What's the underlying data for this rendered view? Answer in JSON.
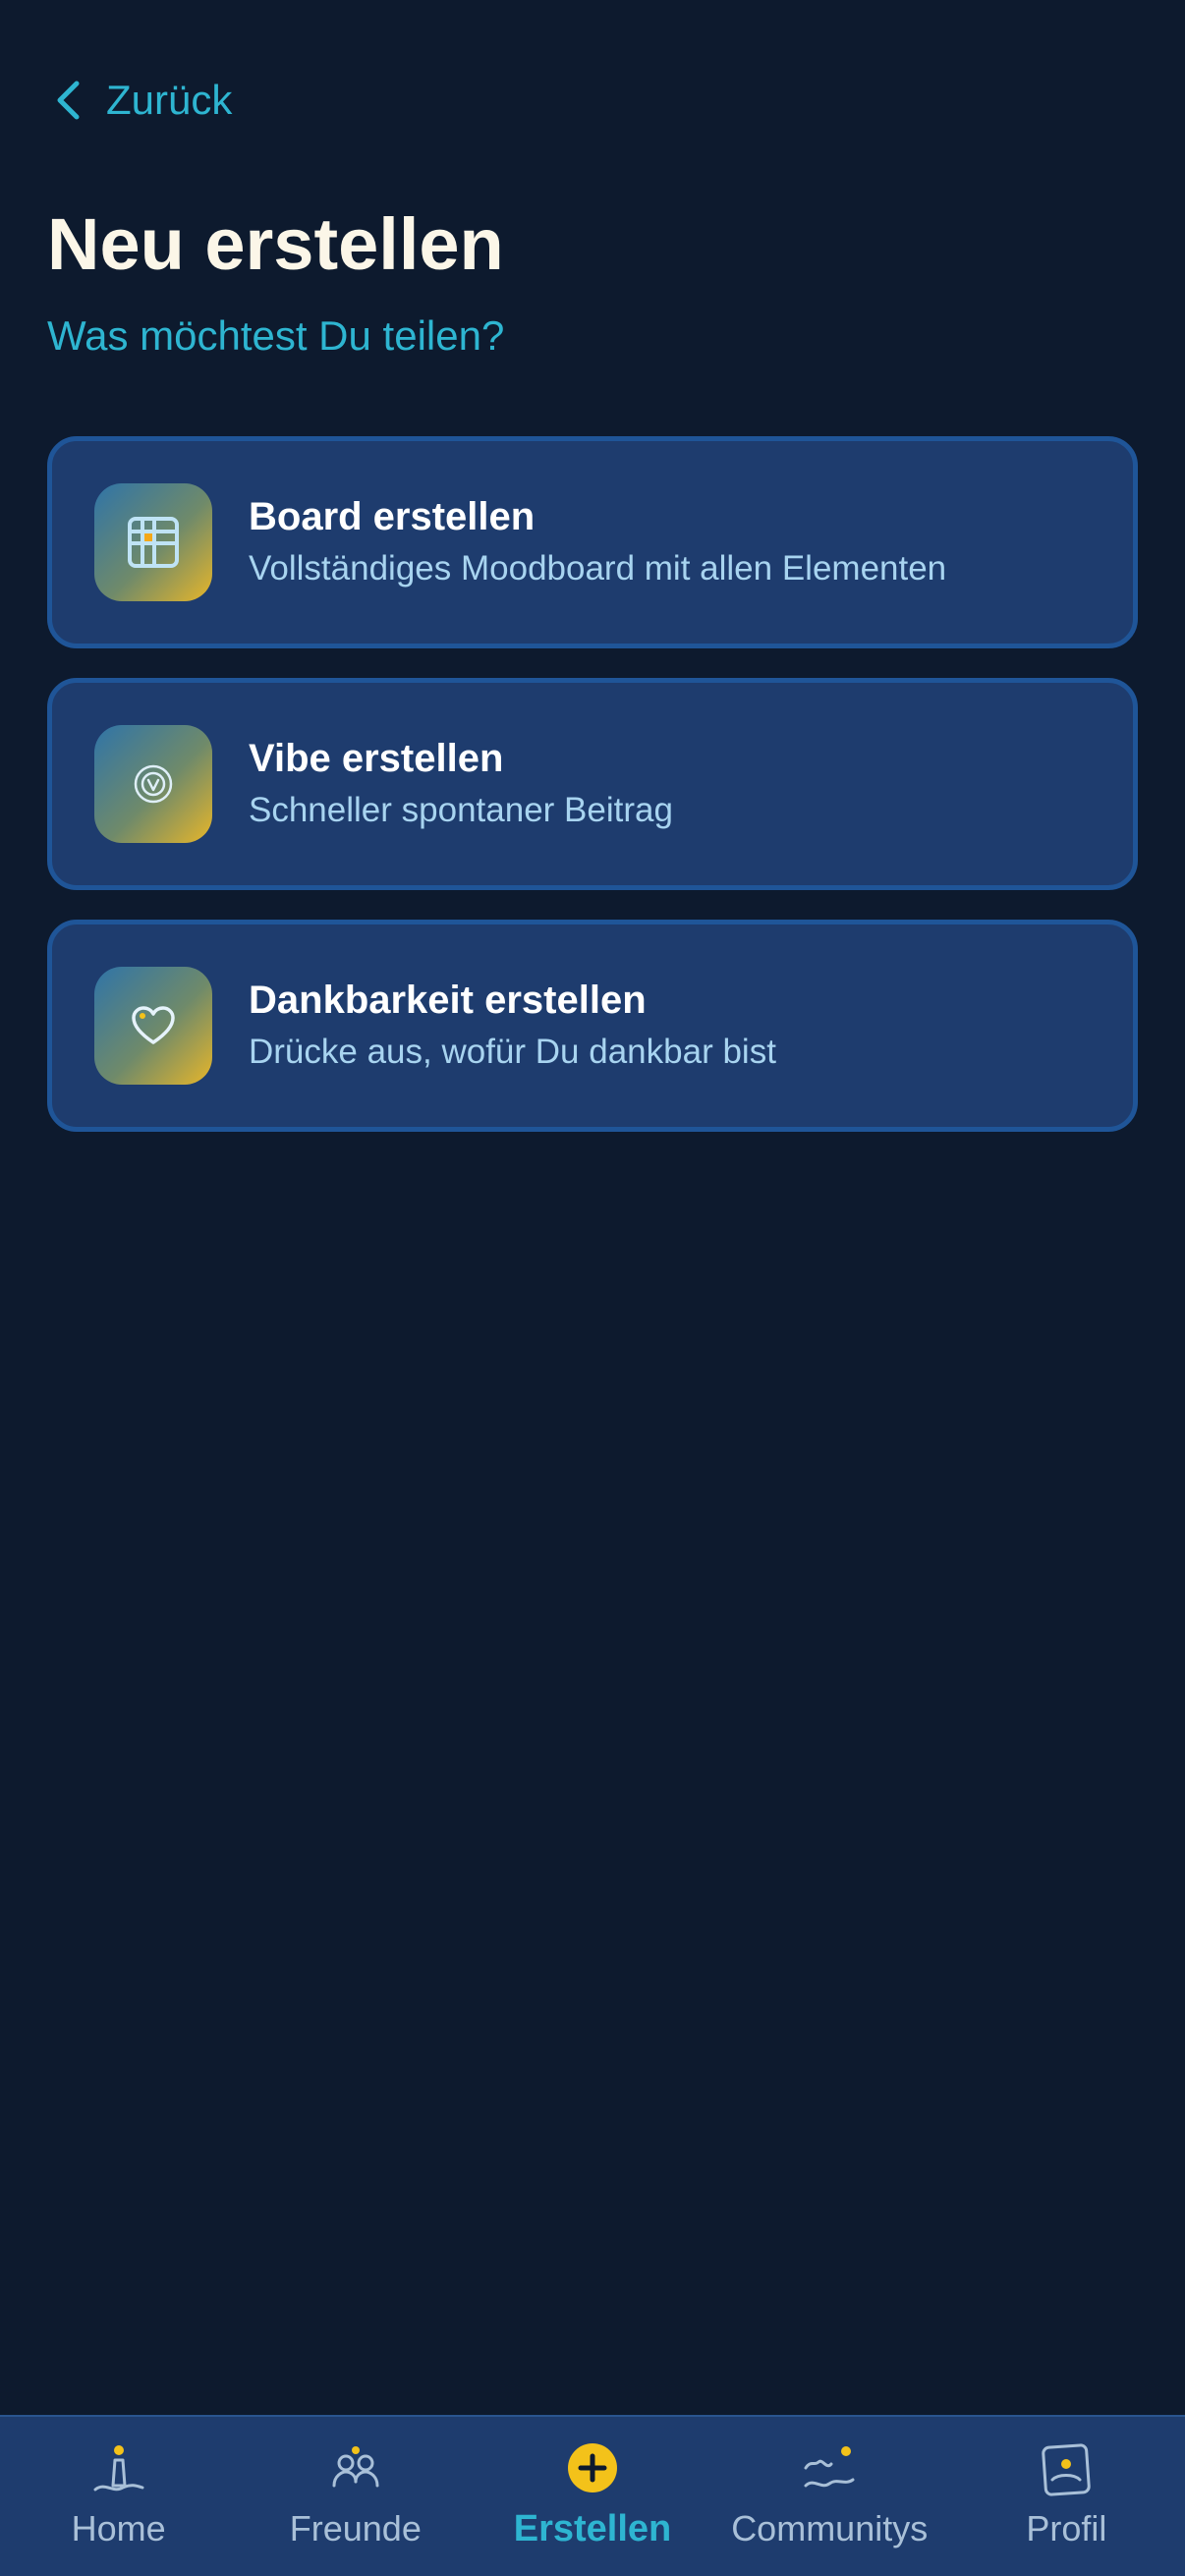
{
  "header": {
    "back_label": "Zurück",
    "title": "Neu erstellen",
    "subtitle": "Was möchtest Du teilen?"
  },
  "options": [
    {
      "icon": "grid-icon",
      "title": "Board erstellen",
      "description": "Vollständiges Moodboard mit allen Elementen"
    },
    {
      "icon": "vibe-icon",
      "title": "Vibe erstellen",
      "description": "Schneller spontaner Beitrag"
    },
    {
      "icon": "heart-icon",
      "title": "Dankbarkeit erstellen",
      "description": "Drücke aus, wofür Du dankbar bist"
    }
  ],
  "nav": {
    "active": "Erstellen",
    "items": [
      {
        "icon": "lighthouse-icon",
        "label": "Home"
      },
      {
        "icon": "friends-icon",
        "label": "Freunde"
      },
      {
        "icon": "plus-circle-icon",
        "label": "Erstellen"
      },
      {
        "icon": "waves-icon",
        "label": "Communitys"
      },
      {
        "icon": "profile-icon",
        "label": "Profil"
      }
    ]
  },
  "colors": {
    "background": "#0d1a2e",
    "card": "#1e3c6e",
    "card_border": "#1f5598",
    "accent_cyan": "#2eb5d1",
    "accent_yellow": "#f3c21a",
    "title": "#fbf6e8"
  }
}
